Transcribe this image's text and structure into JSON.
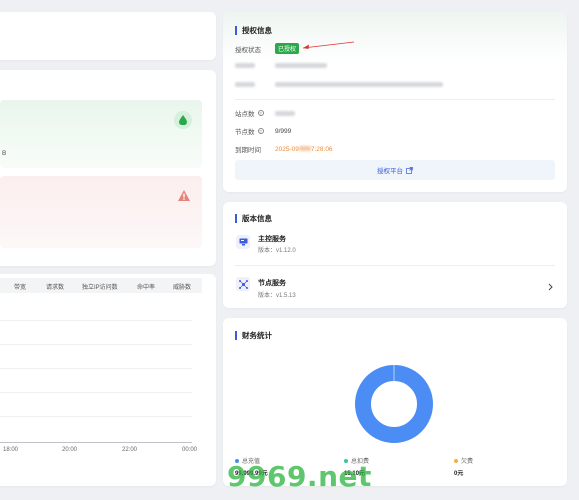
{
  "license": {
    "title": "授权信息",
    "status_label": "授权状态",
    "status_value": "已授权",
    "sites_label": "站点数",
    "nodes_label": "节点数",
    "nodes_value": "9/999",
    "expire_label": "到期时间",
    "expire_value_prefix": "2025-09",
    "expire_value_suffix": "7:28:06",
    "platform_link": "授权平台",
    "colors": {
      "accent": "#3b5bdb",
      "badge": "#2aa84a",
      "expire": "#f08c3a",
      "arrow": "#e03131"
    }
  },
  "version": {
    "title": "版本信息",
    "services": [
      {
        "name": "主控服务",
        "version": "版本：v1.12.0",
        "icon": "monitor-icon"
      },
      {
        "name": "节点服务",
        "version": "版本：v1.5.13",
        "icon": "nodes-icon"
      }
    ]
  },
  "finance": {
    "title": "财务统计",
    "legend": [
      {
        "label": "总充值",
        "value": "99,999.99元",
        "color": "#4c8cf5"
      },
      {
        "label": "总扣费",
        "value": "15.10元",
        "color": "#3cc59a"
      },
      {
        "label": "欠费",
        "value": "0元",
        "color": "#f6b042"
      }
    ]
  },
  "left_panel": {
    "card_text": "B",
    "table_headers": [
      "带宽",
      "请求数",
      "独立IP访问数",
      "命中率",
      "威胁数"
    ],
    "x_ticks": [
      "18:00",
      "20:00",
      "22:00",
      "00:00"
    ]
  },
  "watermark": "9969.net"
}
